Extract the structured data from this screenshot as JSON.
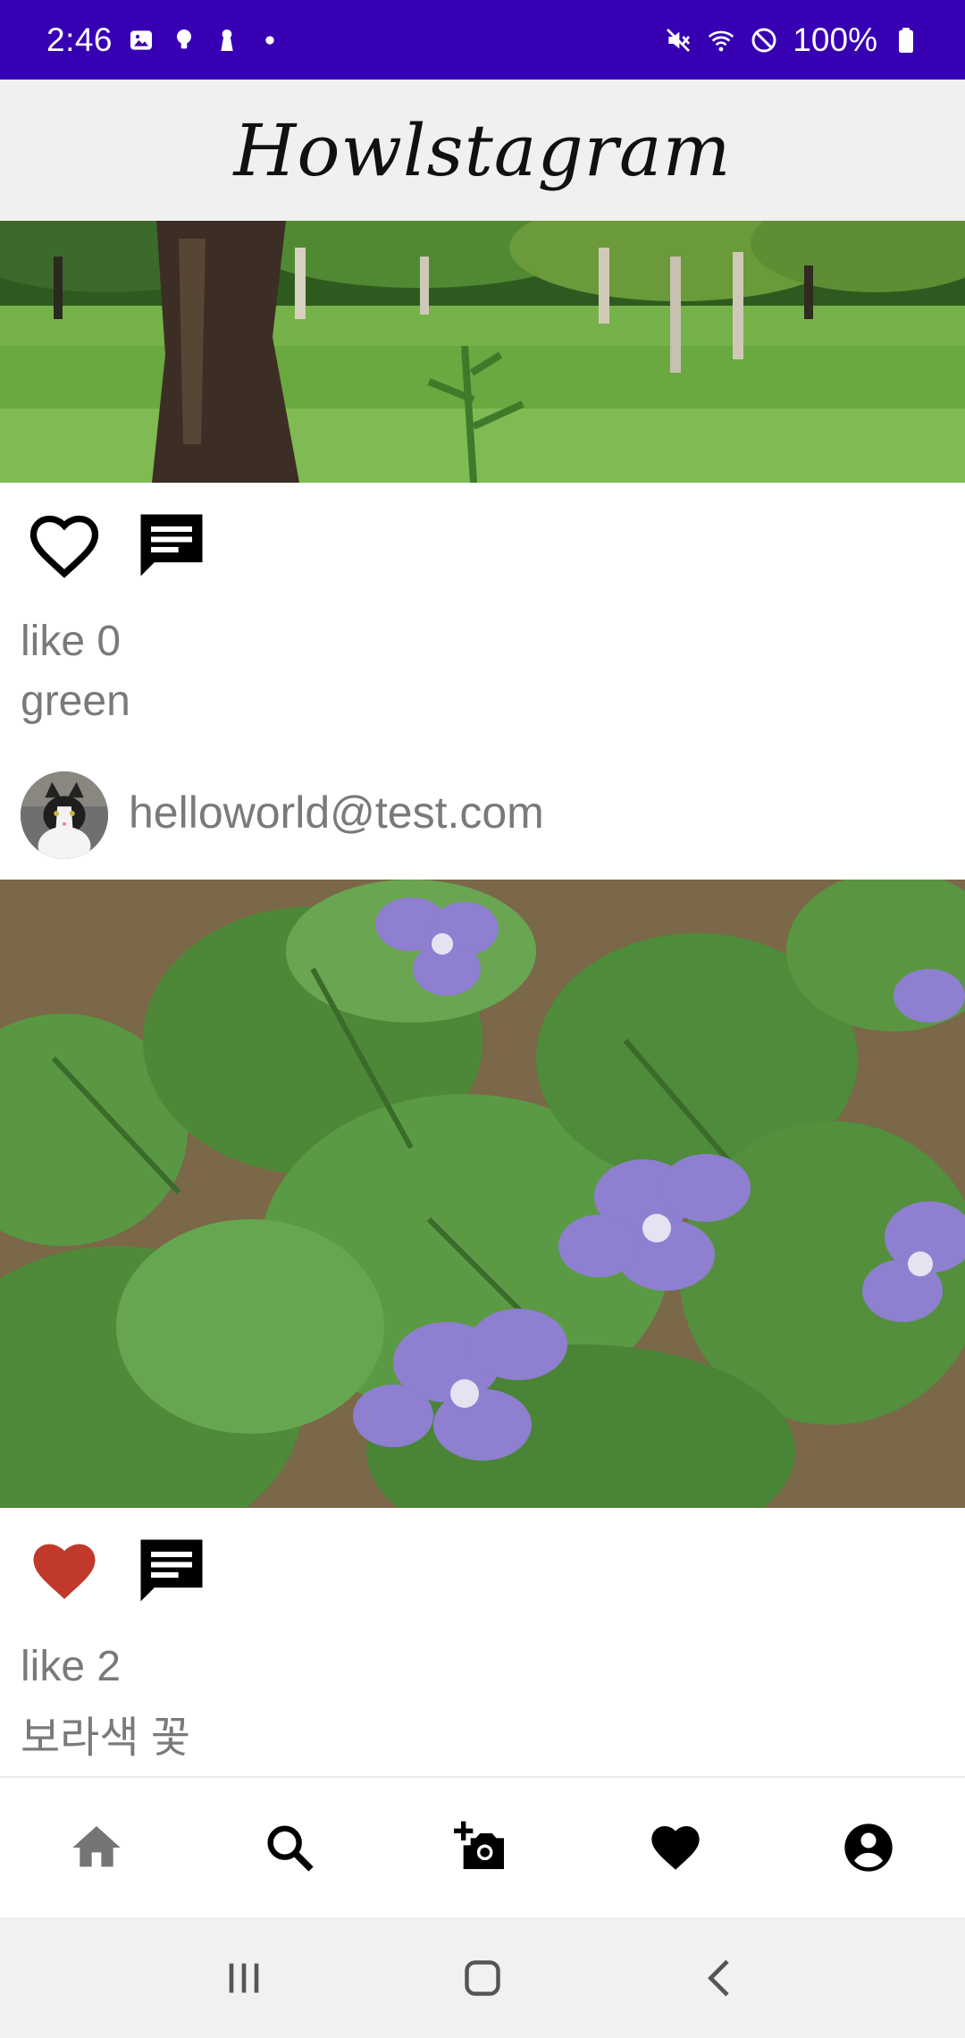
{
  "status_bar": {
    "time": "2:46",
    "battery_pct": "100%",
    "left_icons": [
      "gallery-icon",
      "bulb-icon",
      "keyhole-icon",
      "dot-icon"
    ],
    "right_icons": [
      "mute-icon",
      "wifi-icon",
      "block-icon",
      "battery-icon"
    ],
    "background": "#3700b3"
  },
  "app_bar": {
    "title": "Howlstagram",
    "background": "#f0f0f0"
  },
  "posts": [
    {
      "image": "park-grass-photo",
      "liked": false,
      "like_text": "like 0",
      "caption": "green"
    },
    {
      "user_email": "helloworld@test.com",
      "avatar": "cat-avatar",
      "image": "violet-flowers-photo",
      "liked": true,
      "like_text": "like 2",
      "caption": "보라색 꽃"
    }
  ],
  "colors": {
    "liked_heart": "#c0392b",
    "text_grey": "#7a7a7a"
  },
  "bottom_nav": [
    "home-icon",
    "search-icon",
    "add-photo-icon",
    "favorite-icon",
    "account-icon"
  ],
  "system_nav": [
    "recents-icon",
    "home-button-icon",
    "back-icon"
  ]
}
